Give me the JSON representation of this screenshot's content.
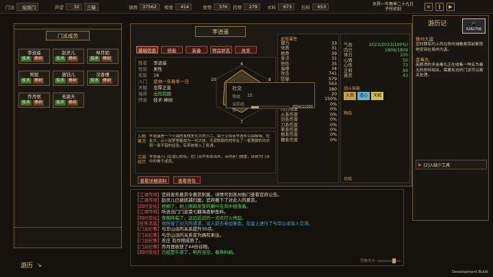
{
  "topbar": {
    "sect_name": "仙剑门",
    "prestige_label": "声望",
    "prestige_value": "32",
    "level_value": "三级",
    "resources": [
      {
        "label": "银两",
        "value": "37562"
      },
      {
        "label": "粮食",
        "value": "414"
      },
      {
        "label": "食物",
        "value": "376"
      },
      {
        "label": "药物",
        "value": "279"
      },
      {
        "label": "木料",
        "value": "673"
      },
      {
        "label": "石料",
        "value": "653"
      }
    ],
    "date": "天昇一年春季二十九日",
    "time": "子时初刻"
  },
  "left": {
    "title": "门派成员",
    "members": [
      {
        "name": "李逍遥",
        "tag1": "技术",
        "tag2": "棒树"
      },
      {
        "name": "赵灵儿",
        "tag1": "技术",
        "tag2": "棒树"
      },
      {
        "name": "林月如",
        "tag1": "技术",
        "tag2": "棒树"
      },
      {
        "name": "阿奴",
        "tag1": "技术",
        "tag2": "棒树"
      },
      {
        "name": "唐钰儿",
        "tag1": "技术",
        "tag2": "棒树"
      },
      {
        "name": "况香槿",
        "tag1": "技术",
        "tag2": "棒树"
      },
      {
        "name": "乔月悦",
        "tag1": "技术",
        "tag2": "棒树"
      },
      {
        "name": "毛骏天",
        "tag1": "技术",
        "tag2": "棒树"
      }
    ],
    "footer_label": "游历"
  },
  "char": {
    "name": "李逍遥",
    "tabs": [
      "基础信息",
      "技能",
      "装备",
      "物品状态",
      "改变"
    ],
    "info": [
      {
        "k": "姓名",
        "v": "李逍遥"
      },
      {
        "k": "性别",
        "v": "男性"
      },
      {
        "k": "年龄",
        "v": "16"
      },
      {
        "k": "入门",
        "v": "武林一年春季一日"
      },
      {
        "k": "天赋",
        "v": "忠厚正直"
      },
      {
        "k": "境界",
        "v": "出窍前期"
      },
      {
        "k": "师承",
        "v": "技术 棒树"
      }
    ],
    "radar_labels": {
      "top": "4",
      "left": "10",
      "right": "8",
      "bottom": "7",
      "bl": "10",
      "br": "10"
    },
    "bio1": "李逍遥是一个小镇的客栈里长大的小二，由于父母亲早逝所以由婶婶、拉扯大，从小就梦想着成为一代大侠，天资聪颖的他学会了一套蹩脚的功夫和一身不错的经验，后来被卷入了奇遇。",
    "bio2": "李逍遥入门后潜心修炼，在门派中表现出众，深得掌门器重，目前为门派中的骨干成员。",
    "bio_label1": "入物概况",
    "bio_label2": "江湖经历",
    "btn_view": "查看详细资料",
    "btn_close": "查看背包"
  },
  "social_popup": {
    "title": "社交",
    "level_label": "等级",
    "level_value": "15",
    "exp_label": "当前经验",
    "exp_value": "2056/11000",
    "exp_ratio": 0.19
  },
  "stats": {
    "left": [
      {
        "k": "臂力",
        "v": "33"
      },
      {
        "k": "体质",
        "v": "31"
      },
      {
        "k": "根骨",
        "v": "39"
      },
      {
        "k": "身法",
        "v": "31"
      },
      {
        "k": "悟性",
        "v": "35"
      },
      {
        "k": "福缘",
        "v": "34"
      },
      {
        "k": "",
        "v": ""
      },
      {
        "k": "攻击",
        "v": "741"
      },
      {
        "k": "防御",
        "v": "579"
      },
      {
        "k": "命中",
        "v": "563"
      },
      {
        "k": "闪避",
        "v": "180"
      },
      {
        "k": "暴击",
        "v": "20"
      },
      {
        "k": "暴击伤害",
        "v": "150%"
      },
      {
        "k": "气血恢复",
        "v": "0%"
      },
      {
        "k": "内力恢复",
        "v": "0%"
      },
      {
        "k": "火系伤害",
        "v": "0%"
      },
      {
        "k": "剑系伤害",
        "v": "0%"
      },
      {
        "k": "刀系伤害",
        "v": "0%"
      },
      {
        "k": "拳系伤害",
        "v": "0%"
      },
      {
        "k": "棍系伤害",
        "v": "0%"
      },
      {
        "k": "鞭系伤害",
        "v": "0%"
      }
    ],
    "right_head": "气血",
    "right_head_value": "2023/2023(100%)",
    "right": [
      {
        "k": "内力",
        "v": "1809/1809"
      },
      {
        "k": "体力",
        "v": "100"
      },
      {
        "k": "心情",
        "v": "50"
      },
      {
        "k": "心性",
        "v": "72"
      },
      {
        "k": "正邪",
        "v": "99"
      },
      {
        "k": "善恶",
        "v": "43"
      }
    ],
    "section_skill": "战斗技能",
    "section_tags": [
      "入世",
      "道心",
      "天赋"
    ],
    "section_items": "物品",
    "section_bottom": "功技",
    "section_root": "武技属性"
  },
  "log": {
    "lines": [
      {
        "tag": "【江湖传闻】",
        "text": "官府发布悬赏令悬赏刺客，详情可到各州衙门查看官府公告。",
        "color": "#e8dcc0"
      },
      {
        "tag": "【江湖传闻】",
        "text": "赵灵儿已被抓捕归案，官府撤下了对此人的悬赏。",
        "color": "#e8dcc0"
      },
      {
        "tag": "【四时变化】",
        "text": "梧桐了，树上刚刚发芽的嫩叶在风中摇曳着。",
        "color": "#5adc5a"
      },
      {
        "tag": "【江湖传闻】",
        "text": "听说当门门急需七翻海香鲈鱼料。",
        "color": "#e8dcc0"
      },
      {
        "tag": "【四时变化】",
        "text": "夜晚降临了，远远近近的一点点灯火亮起。",
        "color": "#5adc5a"
      },
      {
        "tag": "【任务消息】",
        "text": "你所接了对方的请求，派人前去参加宴会，在金上进行了与华山派深入交流。",
        "color": "#4fa9d6"
      },
      {
        "tag": "【门派纪事】",
        "text": "与华山派的关系提升30点。",
        "color": "#e8dcc0"
      },
      {
        "tag": "【门派纪事】",
        "text": "与华山派的关系变为偶有来往。",
        "color": "#e8dcc0"
      },
      {
        "tag": "【门派纪事】",
        "text": "衣庄 有作物成熟了。",
        "color": "#e8dcc0"
      },
      {
        "tag": "【门派纪事】",
        "text": "乔月悦收获了44份谷物。",
        "color": "#e8dcc0"
      },
      {
        "tag": "【四时变化】",
        "text": "已经是午夜了，明月当空，春寒料峭。",
        "color": "#5adc5a"
      }
    ],
    "font_size_label": "字体大小"
  },
  "right": {
    "title": "游历记",
    "watermark_code": "5262756",
    "sections": [
      {
        "head": "扬州大盗",
        "body": "宜时期有约上尚在扬州城看悬赏前都现地受到在扬州大盗。"
      },
      {
        "head": "金毒丸",
        "body": "高薪得的多金毒丸正在收集一种名为毒无的奇特相关，需要有志的门派可以离关处理。"
      }
    ],
    "bottom_btn": "[2]入缺少工具"
  },
  "footer": {
    "dev_build": "Development Build"
  }
}
